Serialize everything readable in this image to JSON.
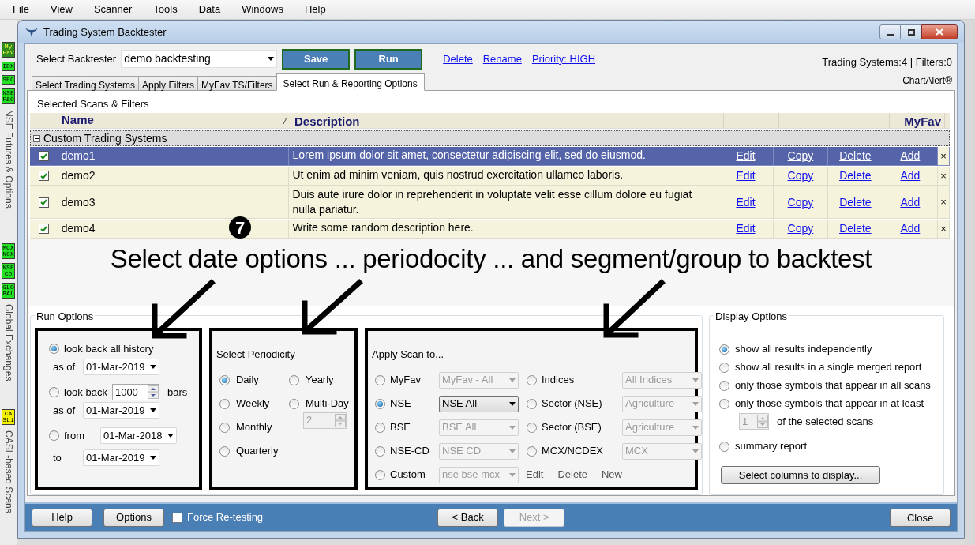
{
  "menu": [
    "File",
    "View",
    "Scanner",
    "Tools",
    "Data",
    "Windows",
    "Help"
  ],
  "side_toolbar": [
    {
      "badges": [
        {
          "label": "My Fav",
          "color": "#2e8b1e"
        },
        {
          "label": "IDX",
          "color": "#22e022"
        },
        {
          "label": "SEC",
          "color": "#22e022"
        },
        {
          "label": "NSE F&O",
          "color": "#22e022"
        }
      ],
      "caption": "NSE Futures & Options"
    },
    {
      "badges": [
        {
          "label": "MCX NCX",
          "color": "#22e022"
        },
        {
          "label": "NSE CD",
          "color": "#22e022"
        },
        {
          "label": "GLO BAL",
          "color": "#22e022"
        }
      ],
      "caption": "Global Exchanges"
    },
    {
      "badges": [
        {
          "label": "CA SLi",
          "color": "#f2f200"
        }
      ],
      "caption": "CASL-based Scans"
    }
  ],
  "window": {
    "title": "Trading System Backtester"
  },
  "toolbar": {
    "select_label": "Select Backtester",
    "select_value": "demo backtesting",
    "buttons": [
      "Save",
      "Run"
    ],
    "links": [
      "Delete",
      "Rename",
      "Priority: HIGH"
    ],
    "status": "Trading Systems:4 | Filters:0",
    "brand": "ChartAlert®"
  },
  "tabs": [
    {
      "label": "Select Trading Systems",
      "selected": false
    },
    {
      "label": "Apply Filters",
      "selected": false
    },
    {
      "label": "MyFav TS/Filters",
      "selected": false
    },
    {
      "label": "Select Run & Reporting Options",
      "selected": true
    }
  ],
  "section_title": "Selected Scans & Filters",
  "table": {
    "columns": {
      "name": "Name",
      "description": "Description",
      "myfav": "MyFav"
    },
    "group": {
      "label": "Custom Trading Systems",
      "expanded": true
    },
    "rows": [
      {
        "name": "demo1",
        "description": "Lorem ipsum dolor sit amet, consectetur adipiscing elit, sed do eiusmod.",
        "checked": true,
        "selected": true,
        "actions": [
          "Edit",
          "Copy",
          "Delete",
          "Add"
        ],
        "remove": "×"
      },
      {
        "name": "demo2",
        "description": "Ut enim ad minim veniam, quis nostrud exercitation ullamco laboris.",
        "checked": true,
        "selected": false,
        "actions": [
          "Edit",
          "Copy",
          "Delete",
          "Add"
        ],
        "remove": "×"
      },
      {
        "name": "demo3",
        "description": "Duis aute irure dolor in reprehenderit in voluptate velit esse cillum dolore eu fugiat nulla pariatur.",
        "checked": true,
        "selected": false,
        "actions": [
          "Edit",
          "Copy",
          "Delete",
          "Add"
        ],
        "remove": "×"
      },
      {
        "name": "demo4",
        "description": "Write some random description here.",
        "checked": true,
        "selected": false,
        "actions": [
          "Edit",
          "Copy",
          "Delete",
          "Add"
        ],
        "remove": "×"
      }
    ]
  },
  "annotation": {
    "number": "7",
    "caption": "Select date options ... periodocity ... and segment/group to backtest"
  },
  "run_options": {
    "title": "Run Options",
    "date_range": [
      {
        "kind": "all",
        "label": "look back all history",
        "selected": true,
        "as_of_label": "as of",
        "date": "01-Mar-2019"
      },
      {
        "kind": "bars",
        "label": "look back",
        "selected": false,
        "bars": "1000",
        "unit": "bars",
        "as_of_label": "as of",
        "date": "01-Mar-2019"
      },
      {
        "kind": "range",
        "label": "from",
        "selected": false,
        "date": "01-Mar-2018",
        "to_label": "to",
        "to_date": "01-Mar-2019"
      }
    ],
    "periodicity": {
      "title": "Select Periodicity",
      "columns": [
        [
          {
            "label": "Daily",
            "selected": true
          },
          {
            "label": "Weekly",
            "selected": false
          },
          {
            "label": "Monthly",
            "selected": false
          },
          {
            "label": "Quarterly",
            "selected": false
          }
        ],
        [
          {
            "label": "Yearly",
            "selected": false
          },
          {
            "label": "Multi-Day",
            "selected": false,
            "count": "2"
          }
        ]
      ]
    },
    "apply_scan": {
      "title": "Apply Scan to...",
      "columns": [
        [
          {
            "label": "MyFav",
            "selected": false,
            "value": "MyFav - All",
            "disabled": true
          },
          {
            "label": "NSE",
            "selected": true,
            "value": "NSE All",
            "disabled": false
          },
          {
            "label": "BSE",
            "selected": false,
            "value": "BSE All",
            "disabled": true
          },
          {
            "label": "NSE-CD",
            "selected": false,
            "value": "NSE CD",
            "disabled": true
          },
          {
            "label": "Custom",
            "selected": false,
            "value": "nse bse mcx",
            "disabled": true
          }
        ],
        [
          {
            "label": "Indices",
            "selected": false,
            "value": "All Indices",
            "disabled": true
          },
          {
            "label": "Sector (NSE)",
            "selected": false,
            "value": "Agriculture",
            "disabled": true
          },
          {
            "label": "Sector (BSE)",
            "selected": false,
            "value": "Agriculture",
            "disabled": true
          },
          {
            "label": "MCX/NCDEX",
            "selected": false,
            "value": "MCX",
            "disabled": true
          }
        ]
      ],
      "custom_actions": [
        "Edit",
        "Delete",
        "New"
      ]
    }
  },
  "display_options": {
    "title": "Display Options",
    "options": [
      {
        "label": "show all results independently",
        "selected": true
      },
      {
        "label": "show all results in a single merged report",
        "selected": false
      },
      {
        "label": "only those symbols that appear in all scans",
        "selected": false
      },
      {
        "label": "only those symbols that appear in at least",
        "selected": false,
        "count": "1",
        "suffix": "of the selected scans"
      },
      {
        "label": "summary report",
        "selected": false
      }
    ],
    "button": "Select columns to display..."
  },
  "footer": {
    "left_buttons": [
      "Help",
      "Options"
    ],
    "force_retest": {
      "label": "Force Re-testing",
      "checked": false
    },
    "nav": [
      {
        "label": "< Back",
        "disabled": false
      },
      {
        "label": "Next >",
        "disabled": true
      }
    ],
    "close": "Close"
  }
}
